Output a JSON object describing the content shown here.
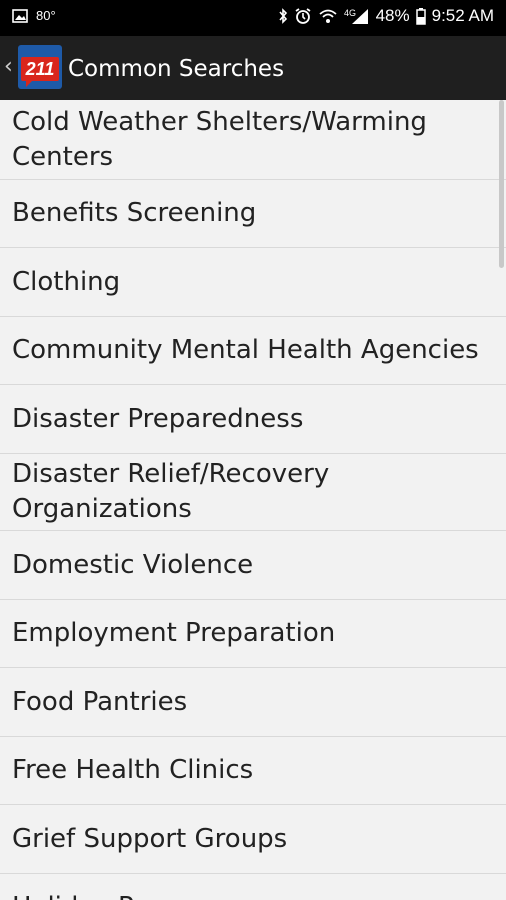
{
  "status_bar": {
    "temperature": "80°",
    "battery": "48%",
    "time": "9:52 AM"
  },
  "app_bar": {
    "back_glyph": "‹",
    "logo_text": "211",
    "title": "Common Searches"
  },
  "list": {
    "items": [
      "Cold Weather Shelters/Warming Centers",
      "Benefits Screening",
      "Clothing",
      "Community Mental Health Agencies",
      "Disaster Preparedness",
      "Disaster Relief/Recovery Organizations",
      "Domestic Violence",
      "Employment Preparation",
      "Food Pantries",
      "Free Health Clinics",
      "Grief Support Groups",
      "Holiday Programs"
    ]
  },
  "colors": {
    "appbar": "#1f1f1f",
    "status_bar": "#000000",
    "list_bg": "#f2f2f2",
    "logo_red": "#d9261c",
    "logo_blue": "#1e5aa8"
  }
}
